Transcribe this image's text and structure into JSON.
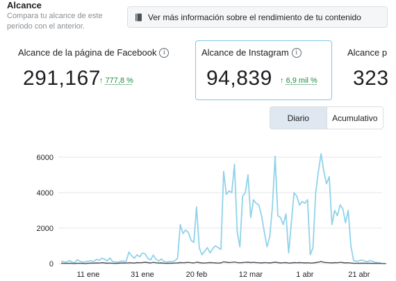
{
  "header": {
    "title": "Alcance",
    "subtitle": "Compara tu alcance de este periodo con el anterior.",
    "info_button": "Ver más información sobre el rendimiento de tu contenido"
  },
  "metrics": [
    {
      "label": "Alcance de la página de Facebook",
      "value": "291,167",
      "delta": "777,8 %"
    },
    {
      "label": "Alcance de Instagram",
      "value": "94,839",
      "delta": "6,9 mil %"
    },
    {
      "label": "Alcance p",
      "value": "323"
    }
  ],
  "toggle": {
    "daily": "Diario",
    "cumulative": "Acumulativo",
    "selected": "Diario"
  },
  "icons": {
    "info": "info-icon",
    "book": "book-icon",
    "arrow": "arrow-up-icon"
  },
  "colors": {
    "instagram_series": "#8fd2ea",
    "facebook_series": "#4b4f56",
    "delta_green": "#1e8a3e",
    "card_border": "#7fc7e8"
  },
  "chart_data": {
    "type": "line",
    "title": "",
    "xlabel": "",
    "ylabel": "",
    "ylim": [
      0,
      6000
    ],
    "yticks": [
      0,
      2000,
      4000,
      6000
    ],
    "xtick_labels": [
      "11 ene",
      "31 ene",
      "20 feb",
      "12 mar",
      "1 abr",
      "21 abr"
    ],
    "xtick_day_index": [
      10,
      30,
      50,
      70,
      90,
      110
    ],
    "grid": true,
    "series": [
      {
        "color": "#8fd2ea",
        "values": [
          150,
          100,
          80,
          180,
          90,
          60,
          220,
          120,
          80,
          100,
          140,
          160,
          110,
          240,
          180,
          300,
          260,
          140,
          320,
          110,
          90,
          80,
          130,
          150,
          120,
          650,
          450,
          300,
          500,
          380,
          600,
          550,
          300,
          200,
          480,
          250,
          140,
          260,
          120,
          80,
          120,
          100,
          160,
          300,
          2200,
          1700,
          1900,
          1750,
          1300,
          1200,
          3200,
          900,
          500,
          700,
          900,
          600,
          850,
          1000,
          900,
          800,
          5200,
          3900,
          4100,
          4000,
          5600,
          1800,
          950,
          3800,
          4000,
          5000,
          2600,
          3600,
          3400,
          3300,
          2700,
          1800,
          950,
          1500,
          3200,
          6050,
          2700,
          2600,
          2200,
          2800,
          600,
          2300,
          4000,
          3800,
          3300,
          3500,
          3400,
          3600,
          500,
          900,
          4000,
          5200,
          6200,
          5200,
          4500,
          4900,
          2200,
          3000,
          2700,
          3300,
          3100,
          2300,
          3000,
          1000,
          180,
          120,
          160,
          200,
          150,
          100,
          180,
          120,
          80,
          60,
          50
        ]
      },
      {
        "color": "#4b4f56",
        "values": [
          20,
          15,
          10,
          25,
          10,
          5,
          20,
          15,
          10,
          5,
          20,
          30,
          25,
          40,
          30,
          50,
          40,
          20,
          30,
          15,
          10,
          20,
          30,
          40,
          30,
          50,
          40,
          30,
          60,
          50,
          60,
          80,
          60,
          40,
          70,
          50,
          30,
          40,
          20,
          15,
          20,
          25,
          30,
          40,
          60,
          50,
          60,
          70,
          50,
          40,
          80,
          60,
          40,
          30,
          50,
          60,
          50,
          40,
          30,
          40,
          100,
          80,
          60,
          70,
          90,
          60,
          50,
          60,
          70,
          80,
          60,
          70,
          60,
          50,
          40,
          60,
          50,
          40,
          60,
          80,
          60,
          40,
          50,
          60,
          30,
          40,
          60,
          50,
          60,
          50,
          40,
          50,
          30,
          40,
          60,
          80,
          120,
          70,
          60,
          50,
          40,
          60,
          50,
          70,
          60,
          40,
          50,
          30,
          20,
          15,
          20,
          25,
          20,
          15,
          20,
          10,
          15,
          10,
          10,
          5,
          5
        ]
      }
    ]
  }
}
